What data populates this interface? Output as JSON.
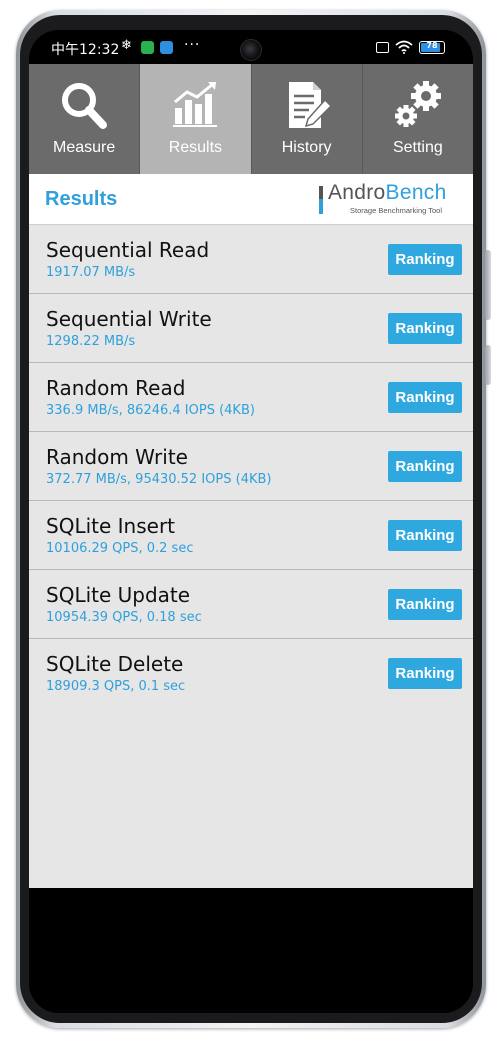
{
  "status_bar": {
    "time": "中午12:32",
    "snow_icon": "snowflake-icon",
    "dots": "···",
    "battery": "78"
  },
  "tabs": [
    {
      "label": "Measure",
      "icon": "magnifier-icon",
      "active": false
    },
    {
      "label": "Results",
      "icon": "bar-chart-icon",
      "active": true
    },
    {
      "label": "History",
      "icon": "document-pencil-icon",
      "active": false
    },
    {
      "label": "Setting",
      "icon": "gears-icon",
      "active": false
    }
  ],
  "header": {
    "title": "Results",
    "logo_andro": "Andro",
    "logo_bench": "Bench",
    "logo_tagline": "Storage Benchmarking Tool"
  },
  "results": [
    {
      "name": "Sequential Read",
      "value": "1917.07 MB/s",
      "button": "Ranking"
    },
    {
      "name": "Sequential Write",
      "value": "1298.22 MB/s",
      "button": "Ranking"
    },
    {
      "name": "Random Read",
      "value": "336.9 MB/s, 86246.4 IOPS (4KB)",
      "button": "Ranking"
    },
    {
      "name": "Random Write",
      "value": "372.77 MB/s, 95430.52 IOPS (4KB)",
      "button": "Ranking"
    },
    {
      "name": "SQLite Insert",
      "value": "10106.29 QPS, 0.2 sec",
      "button": "Ranking"
    },
    {
      "name": "SQLite Update",
      "value": "10954.39 QPS, 0.18 sec",
      "button": "Ranking"
    },
    {
      "name": "SQLite Delete",
      "value": "18909.3 QPS, 0.1 sec",
      "button": "Ranking"
    }
  ],
  "colors": {
    "accent": "#2fa0dc",
    "tab_bg": "#6b6b6b",
    "tab_active_bg": "#b4b4b4",
    "list_bg": "#e6e6e6"
  }
}
